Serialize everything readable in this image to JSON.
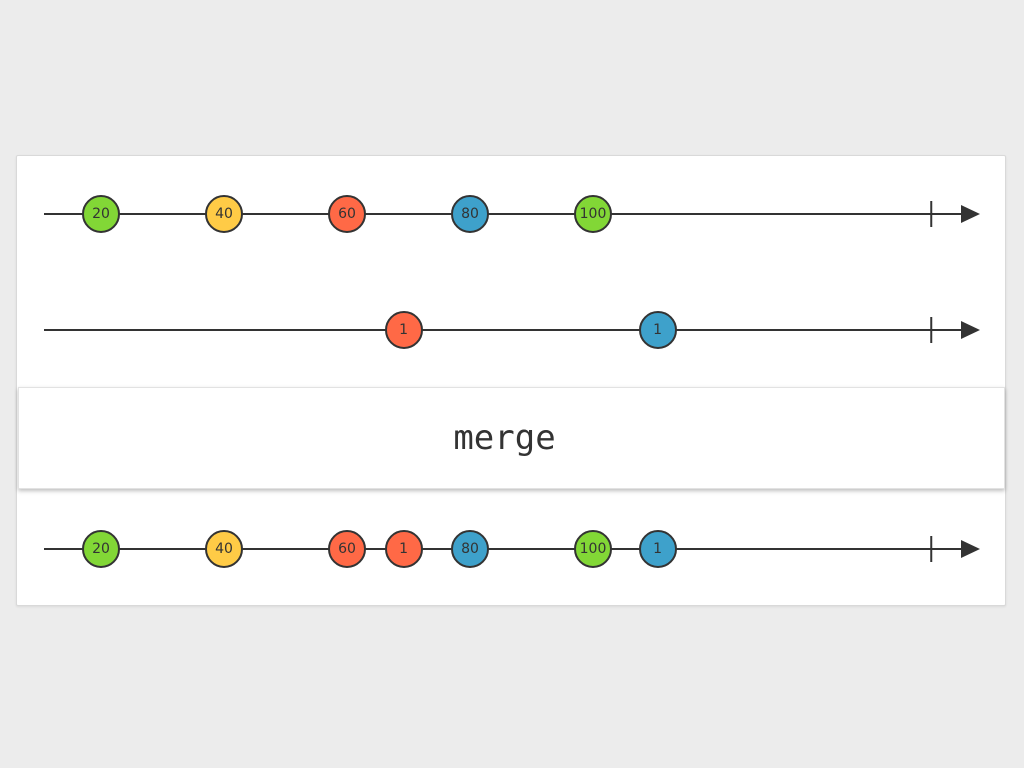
{
  "operator": {
    "label": "merge"
  },
  "colors": {
    "line": "#333333",
    "green": "#82d736",
    "yellow": "#ffcb46",
    "red": "#ff6946",
    "blue": "#3ea1cb"
  },
  "streams": [
    {
      "id": "input-stream-1",
      "marbles": [
        {
          "label": "20",
          "time": 20,
          "color": "#82d736"
        },
        {
          "label": "40",
          "time": 40,
          "color": "#ffcb46"
        },
        {
          "label": "60",
          "time": 60,
          "color": "#ff6946"
        },
        {
          "label": "80",
          "time": 80,
          "color": "#3ea1cb"
        },
        {
          "label": "100",
          "time": 100,
          "color": "#82d736"
        }
      ],
      "completion_time": 155
    },
    {
      "id": "input-stream-2",
      "marbles": [
        {
          "label": "1",
          "time": 69.2,
          "color": "#ff6946"
        },
        {
          "label": "1",
          "time": 110.5,
          "color": "#3ea1cb"
        }
      ],
      "completion_time": 155
    },
    {
      "id": "output-stream",
      "marbles": [
        {
          "label": "20",
          "time": 20,
          "color": "#82d736"
        },
        {
          "label": "40",
          "time": 40,
          "color": "#ffcb46"
        },
        {
          "label": "60",
          "time": 60,
          "color": "#ff6946"
        },
        {
          "label": "1",
          "time": 69.2,
          "color": "#ff6946"
        },
        {
          "label": "80",
          "time": 80,
          "color": "#3ea1cb"
        },
        {
          "label": "100",
          "time": 100,
          "color": "#82d736"
        },
        {
          "label": "1",
          "time": 110.5,
          "color": "#3ea1cb"
        }
      ],
      "completion_time": 155
    }
  ]
}
